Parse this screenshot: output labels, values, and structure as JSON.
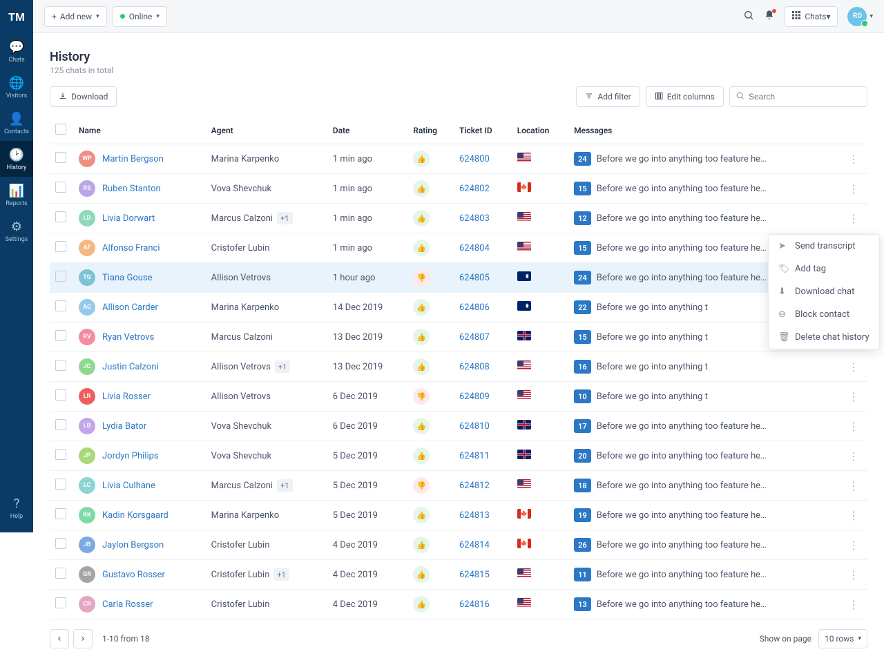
{
  "logo": "TM",
  "sidebar": [
    {
      "icon": "💬",
      "label": "Chats",
      "active": false
    },
    {
      "icon": "🌐",
      "label": "Visitors",
      "active": false
    },
    {
      "icon": "👤",
      "label": "Contacts",
      "active": false
    },
    {
      "icon": "🕑",
      "label": "History",
      "active": true
    },
    {
      "icon": "📊",
      "label": "Reports",
      "active": false
    },
    {
      "icon": "⚙",
      "label": "Settings",
      "active": false
    }
  ],
  "help": {
    "icon": "?",
    "label": "Help"
  },
  "topbar": {
    "add_new": "Add new",
    "status": "Online",
    "apps_label": "Chats",
    "avatar_initials": "RO"
  },
  "page": {
    "title": "History",
    "subtitle": "125 chats in total"
  },
  "toolbar": {
    "download": "Download",
    "add_filter": "Add filter",
    "edit_columns": "Edit columns",
    "search_placeholder": "Search"
  },
  "columns": [
    "",
    "Name",
    "Agent",
    "Date",
    "Rating",
    "Ticket ID",
    "Location",
    "Messages",
    ""
  ],
  "rows": [
    {
      "avatar": "WP",
      "color": "#f08d83",
      "name": "Martin Bergson",
      "agent": "Marina Karpenko",
      "extra": null,
      "date": "1 min ago",
      "rating": "up",
      "ticket": "624800",
      "flag": "us",
      "msgcount": 24,
      "msg": "Before we go into anything too feature heavy...",
      "highlight": false
    },
    {
      "avatar": "RS",
      "color": "#b9a5e8",
      "name": "Ruben Stanton",
      "agent": "Vova Shevchuk",
      "extra": null,
      "date": "1 min ago",
      "rating": "up",
      "ticket": "624802",
      "flag": "ca",
      "msgcount": 15,
      "msg": "Before we go into anything too feature heavy...",
      "highlight": false
    },
    {
      "avatar": "LD",
      "color": "#8dd9b8",
      "name": "Livia Dorwart",
      "agent": "Marcus Calzoni",
      "extra": "+1",
      "date": "1 min ago",
      "rating": "up",
      "ticket": "624803",
      "flag": "us",
      "msgcount": 12,
      "msg": "Before we go into anything too feature heavy...",
      "highlight": false
    },
    {
      "avatar": "AF",
      "color": "#f5b77f",
      "name": "Alfonso Franci",
      "agent": "Cristofer Lubin",
      "extra": null,
      "date": "1 min ago",
      "rating": "up",
      "ticket": "624804",
      "flag": "us",
      "msgcount": 15,
      "msg": "Before we go into anything too feature heavy...",
      "highlight": false
    },
    {
      "avatar": "TG",
      "color": "#7ac3d9",
      "name": "Tiana Gouse",
      "agent": "Allison Vetrovs",
      "extra": null,
      "date": "1 hour ago",
      "rating": "down",
      "ticket": "624805",
      "flag": "au",
      "msgcount": 24,
      "msg": "Before we go into anything too feature heavy...",
      "highlight": true
    },
    {
      "avatar": "AC",
      "color": "#96c9ea",
      "name": "Allison Carder",
      "agent": "Marina Karpenko",
      "extra": null,
      "date": "14 Dec 2019",
      "rating": "up",
      "ticket": "624806",
      "flag": "au",
      "msgcount": 22,
      "msg": "Before we go into anything t",
      "highlight": false
    },
    {
      "avatar": "RV",
      "color": "#f58b9e",
      "name": "Ryan Vetrovs",
      "agent": "Marcus Calzoni",
      "extra": null,
      "date": "13 Dec 2019",
      "rating": "up",
      "ticket": "624807",
      "flag": "gb",
      "msgcount": 15,
      "msg": "Before we go into anything t",
      "highlight": false
    },
    {
      "avatar": "JC",
      "color": "#8fd98f",
      "name": "Justin Calzoni",
      "agent": "Allison Vetrovs",
      "extra": "+1",
      "date": "13 Dec 2019",
      "rating": "up",
      "ticket": "624808",
      "flag": "us",
      "msgcount": 16,
      "msg": "Before we go into anything t",
      "highlight": false
    },
    {
      "avatar": "LR",
      "color": "#ef5e5e",
      "name": "Livia Rosser",
      "agent": "Allison Vetrovs",
      "extra": null,
      "date": "6 Dec 2019",
      "rating": "down",
      "ticket": "624809",
      "flag": "us",
      "msgcount": 10,
      "msg": "Before we go into anything t",
      "highlight": false
    },
    {
      "avatar": "LB",
      "color": "#c3a5e8",
      "name": "Lydia Bator",
      "agent": "Vova Shevchuk",
      "extra": null,
      "date": "6 Dec 2019",
      "rating": "up",
      "ticket": "624810",
      "flag": "gb",
      "msgcount": 17,
      "msg": "Before we go into anything too feature heavy...",
      "highlight": false
    },
    {
      "avatar": "JP",
      "color": "#a8d97a",
      "name": "Jordyn Philips",
      "agent": "Vova Shevchuk",
      "extra": null,
      "date": "5 Dec 2019",
      "rating": "up",
      "ticket": "624811",
      "flag": "gb",
      "msgcount": 20,
      "msg": "Before we go into anything too feature heavy...",
      "highlight": false
    },
    {
      "avatar": "LC",
      "color": "#8dd4d4",
      "name": "Livia Culhane",
      "agent": "Marcus Calzoni",
      "extra": "+1",
      "date": "5 Dec 2019",
      "rating": "down",
      "ticket": "624812",
      "flag": "us",
      "msgcount": 18,
      "msg": "Before we go into anything too feature heavy...",
      "highlight": false
    },
    {
      "avatar": "KK",
      "color": "#82d9a8",
      "name": "Kadin Korsgaard",
      "agent": "Marina Karpenko",
      "extra": null,
      "date": "5 Dec 2019",
      "rating": "up",
      "ticket": "624813",
      "flag": "ca",
      "msgcount": 19,
      "msg": "Before we go into anything too feature heavy...",
      "highlight": false
    },
    {
      "avatar": "JB",
      "color": "#7aa9e5",
      "name": "Jaylon Bergson",
      "agent": "Cristofer Lubin",
      "extra": null,
      "date": "4 Dec 2019",
      "rating": "up",
      "ticket": "624814",
      "flag": "ca",
      "msgcount": 26,
      "msg": "Before we go into anything too feature heavy...",
      "highlight": false
    },
    {
      "avatar": "GR",
      "color": "#a5a5a5",
      "name": "Gustavo Rosser",
      "agent": "Cristofer Lubin",
      "extra": "+1",
      "date": "4 Dec 2019",
      "rating": "up",
      "ticket": "624815",
      "flag": "us",
      "msgcount": 11,
      "msg": "Before we go into anything too feature heavy...",
      "highlight": false
    },
    {
      "avatar": "CR",
      "color": "#e5a5c3",
      "name": "Carla Rosser",
      "agent": "Cristofer Lubin",
      "extra": null,
      "date": "4 Dec 2019",
      "rating": "up",
      "ticket": "624816",
      "flag": "us",
      "msgcount": 13,
      "msg": "Before we go into anything too feature heavy...",
      "highlight": false
    }
  ],
  "context_menu": [
    {
      "icon": "➤",
      "label": "Send transcript"
    },
    {
      "icon": "🏷",
      "label": "Add tag"
    },
    {
      "icon": "⬇",
      "label": "Download chat"
    },
    {
      "icon": "⊖",
      "label": "Block contact"
    },
    {
      "icon": "🗑",
      "label": "Delete chat history"
    }
  ],
  "pagination": {
    "info": "1-10 from 18",
    "show_label": "Show on page",
    "rows": "10 rows"
  }
}
